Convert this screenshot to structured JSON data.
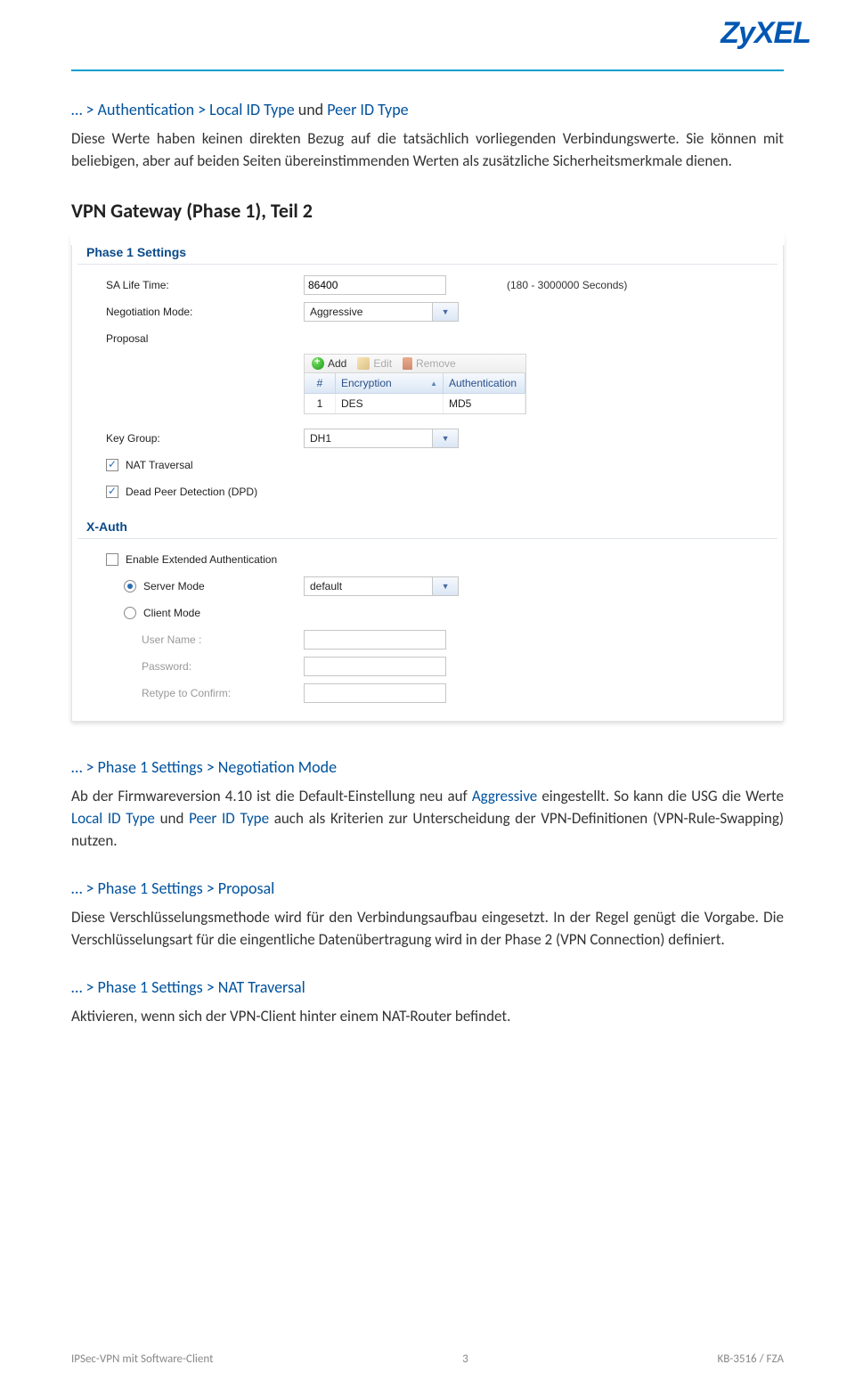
{
  "brand": "ZyXEL",
  "breadcrumb1": "… > Authentication > Local ID Type",
  "breadcrumb1_mid": " und ",
  "breadcrumb1_b": "Peer ID Type",
  "para1": "Diese Werte haben keinen direkten Bezug auf die tatsächlich vorliegenden Verbindungswerte. Sie können mit beliebigen, aber auf beiden Seiten übereinstimmenden Werten als zusätzliche Sicherheitsmerkmale dienen.",
  "section_title": "VPN Gateway (Phase 1), Teil 2",
  "panel": {
    "header1": "Phase 1 Settings",
    "sa_life_label": "SA Life Time:",
    "sa_life_value": "86400",
    "sa_life_hint": "(180 - 3000000 Seconds)",
    "neg_label": "Negotiation Mode:",
    "neg_value": "Aggressive",
    "proposal_label": "Proposal",
    "toolbar": {
      "add": "Add",
      "edit": "Edit",
      "remove": "Remove"
    },
    "grid": {
      "h1": "#",
      "h2": "Encryption",
      "h3": "Authentication",
      "r1c1": "1",
      "r1c2": "DES",
      "r1c3": "MD5"
    },
    "keygroup_label": "Key Group:",
    "keygroup_value": "DH1",
    "nat_traversal": "NAT Traversal",
    "dpd": "Dead Peer Detection (DPD)",
    "header2": "X-Auth",
    "enable_ext": "Enable Extended Authentication",
    "server_mode": "Server Mode",
    "server_mode_value": "default",
    "client_mode": "Client Mode",
    "user_name": "User Name :",
    "password": "Password:",
    "retype": "Retype to Confirm:"
  },
  "breadcrumb2": "… > Phase 1 Settings > Negotiation Mode",
  "para2_a": "Ab der Firmwareversion 4.10 ist die Default-Einstellung neu auf ",
  "para2_aggressive": "Aggressive",
  "para2_b": " eingestellt. So kann die USG die Werte ",
  "para2_local": "Local ID Type",
  "para2_c": " und ",
  "para2_peer": "Peer ID Type",
  "para2_d": " auch als Kriterien zur Unterscheidung der VPN-Definitionen (VPN-Rule-Swapping) nutzen.",
  "breadcrumb3": "… > Phase 1 Settings > Proposal",
  "para3": "Diese Verschlüsselungsmethode wird für den Verbindungsaufbau eingesetzt. In der Regel genügt die Vorgabe. Die Verschlüsselungsart für die eingentliche Datenübertragung wird in der Phase 2 (VPN Connection) definiert.",
  "breadcrumb4": "… > Phase 1 Settings > NAT Traversal",
  "para4": "Aktivieren, wenn sich der VPN-Client hinter einem NAT-Router befindet.",
  "footer": {
    "left": "IPSec-VPN mit Software-Client",
    "center": "3",
    "right": "KB-3516 / FZA"
  }
}
